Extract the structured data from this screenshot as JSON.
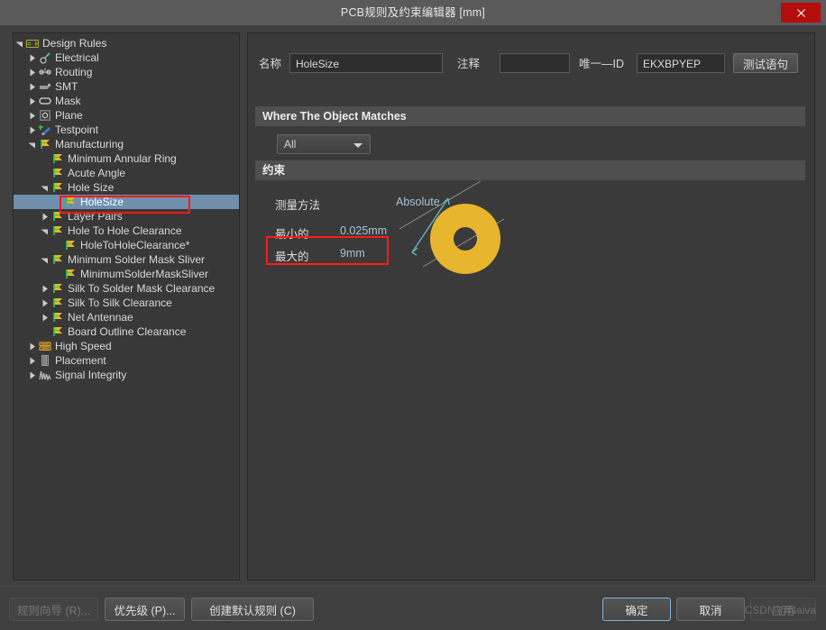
{
  "window": {
    "title": "PCB规则及约束编辑器 [mm]",
    "close_label": "close-icon"
  },
  "tree": {
    "items": [
      {
        "label": "Design Rules",
        "depth": 0,
        "icon": "design-rules-icon",
        "twisty": "open",
        "selected": false
      },
      {
        "label": "Electrical",
        "depth": 1,
        "icon": "electrical-icon",
        "twisty": "closed",
        "selected": false
      },
      {
        "label": "Routing",
        "depth": 1,
        "icon": "routing-icon",
        "twisty": "closed",
        "selected": false
      },
      {
        "label": "SMT",
        "depth": 1,
        "icon": "smt-icon",
        "twisty": "closed",
        "selected": false
      },
      {
        "label": "Mask",
        "depth": 1,
        "icon": "mask-icon",
        "twisty": "closed",
        "selected": false
      },
      {
        "label": "Plane",
        "depth": 1,
        "icon": "plane-icon",
        "twisty": "closed",
        "selected": false
      },
      {
        "label": "Testpoint",
        "depth": 1,
        "icon": "testpoint-icon",
        "twisty": "closed",
        "selected": false
      },
      {
        "label": "Manufacturing",
        "depth": 1,
        "icon": "rule-flag-icon",
        "twisty": "open",
        "selected": false
      },
      {
        "label": "Minimum Annular Ring",
        "depth": 2,
        "icon": "rule-flag-icon",
        "twisty": "none",
        "selected": false
      },
      {
        "label": "Acute Angle",
        "depth": 2,
        "icon": "rule-flag-icon",
        "twisty": "none",
        "selected": false
      },
      {
        "label": "Hole Size",
        "depth": 2,
        "icon": "rule-flag-icon",
        "twisty": "open",
        "selected": false
      },
      {
        "label": "HoleSize",
        "depth": 3,
        "icon": "rule-flag-icon",
        "twisty": "none",
        "selected": true
      },
      {
        "label": "Layer Pairs",
        "depth": 2,
        "icon": "rule-flag-icon",
        "twisty": "closed",
        "selected": false
      },
      {
        "label": "Hole To Hole Clearance",
        "depth": 2,
        "icon": "rule-flag-icon",
        "twisty": "open",
        "selected": false
      },
      {
        "label": "HoleToHoleClearance*",
        "depth": 3,
        "icon": "rule-flag-icon",
        "twisty": "none",
        "selected": false
      },
      {
        "label": "Minimum Solder Mask Sliver",
        "depth": 2,
        "icon": "rule-flag-icon",
        "twisty": "open",
        "selected": false
      },
      {
        "label": "MinimumSolderMaskSliver",
        "depth": 3,
        "icon": "rule-flag-icon",
        "twisty": "none",
        "selected": false
      },
      {
        "label": "Silk To Solder Mask Clearance",
        "depth": 2,
        "icon": "rule-flag-icon",
        "twisty": "closed",
        "selected": false
      },
      {
        "label": "Silk To Silk Clearance",
        "depth": 2,
        "icon": "rule-flag-icon",
        "twisty": "closed",
        "selected": false
      },
      {
        "label": "Net Antennae",
        "depth": 2,
        "icon": "rule-flag-icon",
        "twisty": "closed",
        "selected": false
      },
      {
        "label": "Board Outline Clearance",
        "depth": 2,
        "icon": "rule-flag-icon",
        "twisty": "none",
        "selected": false
      },
      {
        "label": "High Speed",
        "depth": 1,
        "icon": "high-speed-icon",
        "twisty": "closed",
        "selected": false
      },
      {
        "label": "Placement",
        "depth": 1,
        "icon": "placement-icon",
        "twisty": "closed",
        "selected": false
      },
      {
        "label": "Signal Integrity",
        "depth": 1,
        "icon": "signal-integrity-icon",
        "twisty": "closed",
        "selected": false
      }
    ]
  },
  "detail": {
    "name_label": "名称",
    "name_value": "HoleSize",
    "comment_label": "注释",
    "comment_value": "",
    "unique_id_label": "唯一—ID",
    "unique_id_value": "EKXBPYEP",
    "test_button": "测试语句",
    "where_header": "Where The Object Matches",
    "scope_value": "All",
    "constraints_header": "约束",
    "measure_method_label": "测量方法",
    "measure_method_value": "Absolute",
    "min_label": "最小的",
    "min_value": "0.025mm",
    "max_label": "最大的",
    "max_value": "9mm"
  },
  "footer": {
    "rule_wizard": "规则向导 (R)...",
    "priority": "优先级 (P)...",
    "create_default": "创建默认规则 (C)",
    "ok": "确定",
    "cancel": "取消",
    "apply": "应用",
    "watermark": "CSDN @Naiva"
  },
  "colors": {
    "accent_gold": "#e8b52e",
    "selection_blue": "#6f8fad",
    "annotation_red": "#ff1a1a",
    "value_blue": "#a9c2d8",
    "close_red": "#b50d0d"
  }
}
